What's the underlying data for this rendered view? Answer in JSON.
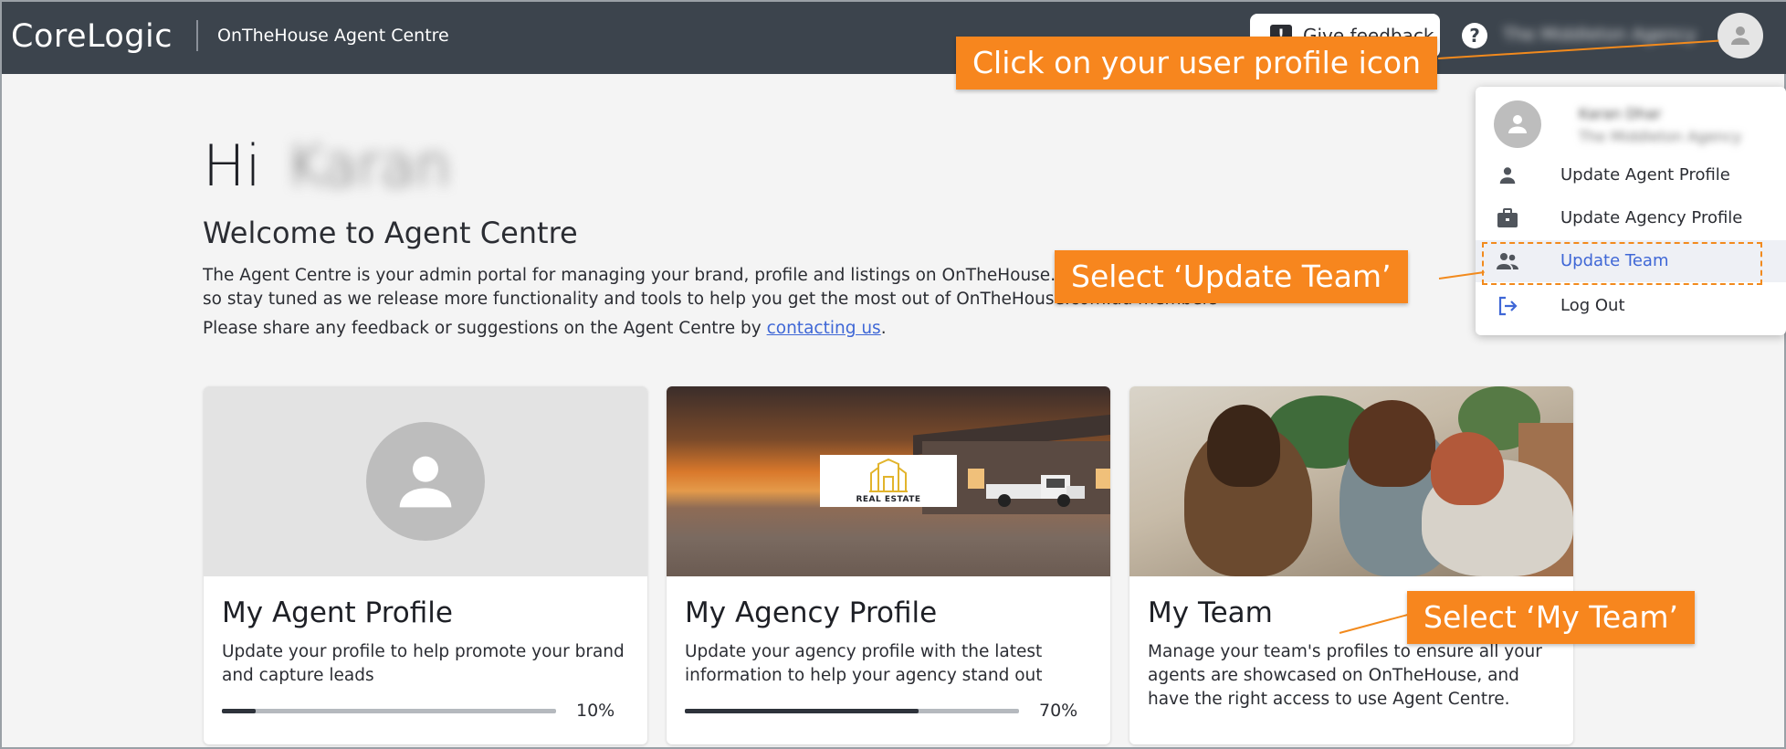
{
  "header": {
    "logo": "CoreLogic",
    "app_name": "OnTheHouse Agent Centre",
    "feedback_label": "Give feedback",
    "help_icon": "?",
    "agency_name": "The Middleton Agency"
  },
  "main": {
    "greeting_prefix": "Hi",
    "greeting_name": "Karan",
    "welcome_title": "Welcome to Agent Centre",
    "intro_line1": "The Agent Centre is your admin portal for managing your brand, profile and listings on OnTheHouse.com.au. We have exciting changes coming,",
    "intro_line2": "so stay tuned as we release more functionality and tools to help you get the most out of OnTheHouse.com.au membership.",
    "feedback_prefix": "Please share any feedback or suggestions on the Agent Centre by ",
    "feedback_link": "contacting us",
    "feedback_suffix": "."
  },
  "cards": [
    {
      "title": "My Agent Profile",
      "description": "Update your profile to help promote your brand and capture leads",
      "progress": 10,
      "progress_label": "10%"
    },
    {
      "title": "My Agency Profile",
      "description": "Update your agency profile with the latest information to help your agency stand out",
      "progress": 70,
      "progress_label": "70%",
      "image_logo_text": "REAL ESTATE"
    },
    {
      "title": "My Team",
      "description": "Manage your team's profiles to ensure all your agents are showcased on OnTheHouse, and have the right access to use Agent Centre."
    }
  ],
  "dropdown": {
    "user_name": "Karan Dhar",
    "user_agency": "The Middleton Agency",
    "items": [
      {
        "label": "Update Agent Profile",
        "icon": "person-icon"
      },
      {
        "label": "Update Agency Profile",
        "icon": "briefcase-icon"
      },
      {
        "label": "Update Team",
        "icon": "team-icon",
        "active": true
      },
      {
        "label": "Log Out",
        "icon": "logout-icon"
      }
    ]
  },
  "callouts": {
    "profile_icon": "Click on your user profile icon",
    "update_team": "Select ‘Update Team’",
    "my_team": "Select ‘My Team’"
  },
  "colors": {
    "header_bg": "#3c444d",
    "callout": "#f7861e",
    "link": "#3f67d6",
    "page_bg": "#f4f4f4"
  }
}
